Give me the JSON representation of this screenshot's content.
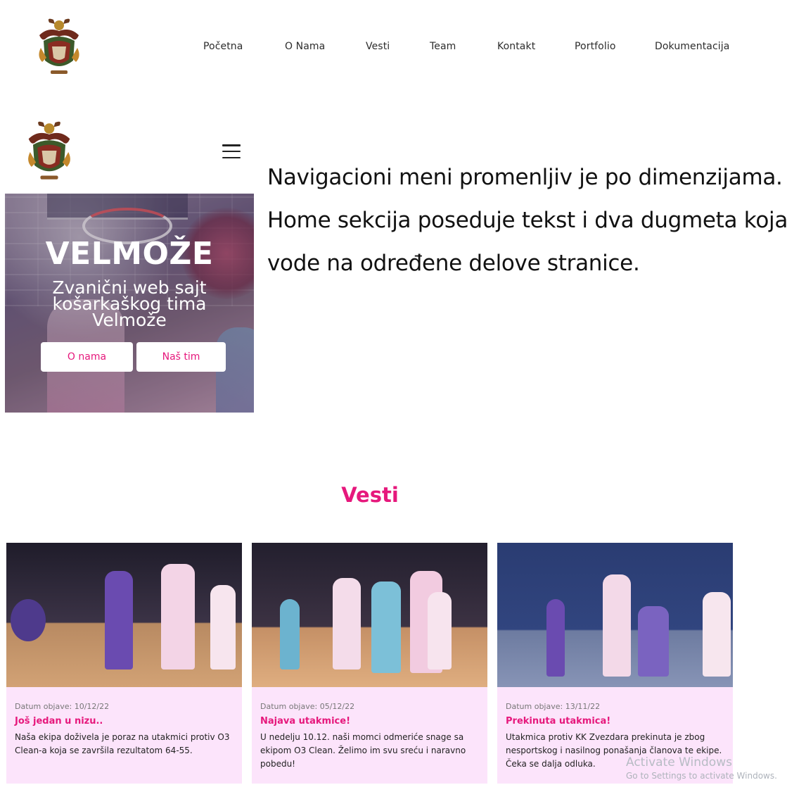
{
  "nav": {
    "items": [
      "Početna",
      "O Nama",
      "Vesti",
      "Team",
      "Kontakt",
      "Portfolio",
      "Dokumentacija"
    ]
  },
  "hero": {
    "title": "VELMOŽE",
    "subtitle": "Zvanični web sajt košarkaškog tima Velmože",
    "button_about": "O nama",
    "button_team": "Naš tim"
  },
  "description": "Navigacioni meni promenljiv je po dimenzijama. Home sekcija poseduje tekst i dva dugmeta koja vode na određene delove stranice.",
  "news": {
    "heading": "Vesti",
    "cards": [
      {
        "date": "Datum objave: 10/12/22",
        "title": "Još jedan u nizu..",
        "text": "Naša ekipa doživela je poraz na utakmici protiv O3 Clean-a koja se završila rezultatom 64-55."
      },
      {
        "date": "Datum objave: 05/12/22",
        "title": "Najava utakmice!",
        "text": "U nedelju 10.12. naši momci odmeriće snage sa ekipom O3 Clean. Želimo im svu sreću i naravno pobedu!"
      },
      {
        "date": "Datum objave: 13/11/22",
        "title": "Prekinuta utakmica!",
        "text": "Utakmica protiv KK Zvezdara prekinuta je zbog nesportskog i nasilnog ponašanja članova te ekipe. Čeka se dalja odluka."
      }
    ]
  },
  "watermark": {
    "line1": "Activate Windows",
    "line2": "Go to Settings to activate Windows."
  },
  "colors": {
    "accent": "#e6187c",
    "card_bg": "#fce4fb"
  },
  "icons": {
    "logo": "crest-logo-icon",
    "menu": "hamburger-menu-icon"
  }
}
